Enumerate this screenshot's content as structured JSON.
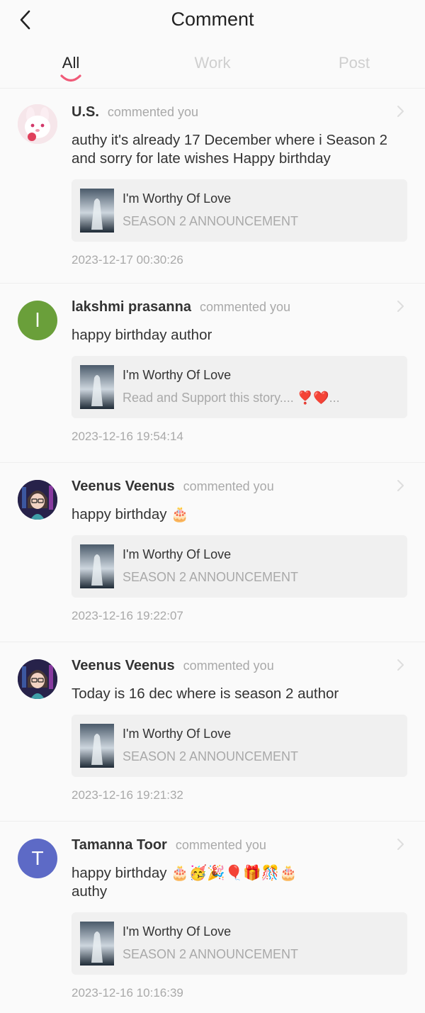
{
  "header": {
    "title": "Comment",
    "back_icon": "chevron-left-icon"
  },
  "tabs": [
    {
      "label": "All",
      "active": true
    },
    {
      "label": "Work",
      "active": false
    },
    {
      "label": "Post",
      "active": false
    }
  ],
  "colors": {
    "accent": "#f05a78",
    "green_avatar": "#6a9f3a",
    "purple_avatar": "#5d6ac6"
  },
  "comments": [
    {
      "name": "U.S.",
      "action": "commented you",
      "text": "authy it's already 17 December where i Season 2 and sorry for late wishes Happy birthday",
      "card": {
        "title": "I'm Worthy Of Love",
        "subtitle": "SEASON 2 ANNOUNCEMENT"
      },
      "time": "2023-12-17 00:30:26",
      "avatar": {
        "type": "image",
        "icon": "bunny-avatar"
      }
    },
    {
      "name": "lakshmi prasanna",
      "action": "commented you",
      "text": "happy birthday author",
      "card": {
        "title": "I'm Worthy Of Love",
        "subtitle": "Read and Support this story.... ❣️❤️..."
      },
      "time": "2023-12-16 19:54:14",
      "avatar": {
        "type": "letter",
        "letter": "l"
      }
    },
    {
      "name": "Veenus Veenus",
      "action": "commented you",
      "text": "happy birthday 🎂",
      "card": {
        "title": "I'm Worthy Of Love",
        "subtitle": "SEASON 2 ANNOUNCEMENT"
      },
      "time": "2023-12-16 19:22:07",
      "avatar": {
        "type": "image",
        "icon": "anime-avatar"
      }
    },
    {
      "name": "Veenus Veenus",
      "action": "commented you",
      "text": "Today is 16 dec where is season 2 author",
      "card": {
        "title": "I'm Worthy Of Love",
        "subtitle": "SEASON 2 ANNOUNCEMENT"
      },
      "time": "2023-12-16 19:21:32",
      "avatar": {
        "type": "image",
        "icon": "anime-avatar"
      }
    },
    {
      "name": "Tamanna Toor",
      "action": "commented you",
      "text": "happy birthday 🎂🥳🎉🎈🎁🎊🎂",
      "text_line2": "authy",
      "card": {
        "title": "I'm Worthy Of Love",
        "subtitle": "SEASON 2 ANNOUNCEMENT"
      },
      "time": "2023-12-16 10:16:39",
      "avatar": {
        "type": "letter",
        "letter": "T"
      }
    }
  ]
}
